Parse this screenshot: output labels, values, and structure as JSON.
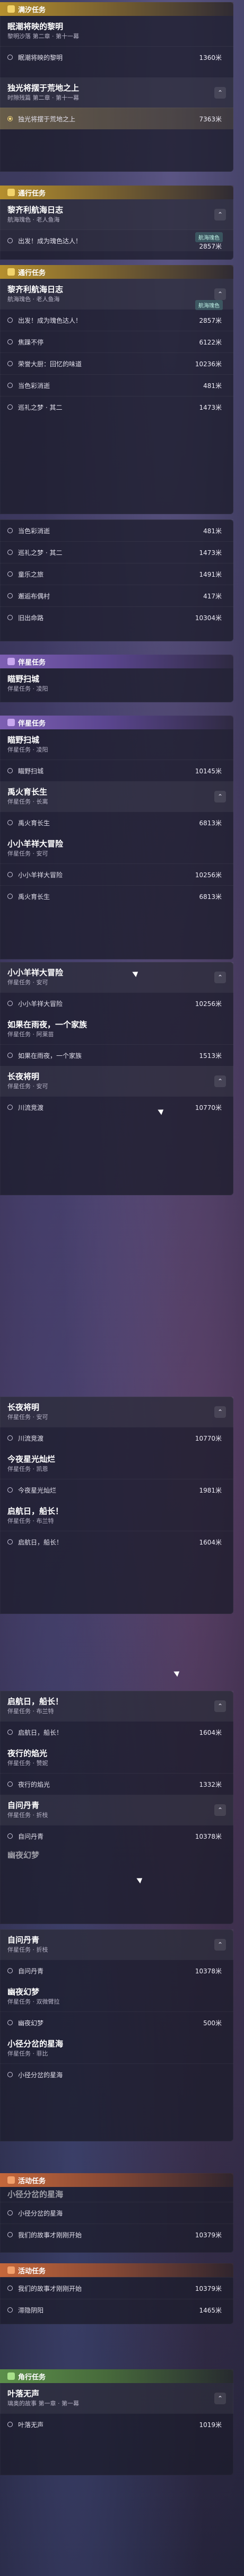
{
  "sec1": {
    "category": "满汐任务",
    "quest1": {
      "title": "眠潮将映的黎明",
      "subtitle": "黎明沙落 第二章 · 第十一幕"
    },
    "quest1_row": {
      "label": "眠潮将映的黎明",
      "value": "1360米"
    },
    "quest2": {
      "title": "独光将摆于荒地之上",
      "subtitle": "时隙残篇 第二章 · 第十一幕"
    },
    "quest2_row": {
      "label": "独光将摆于荒地之上",
      "value": "7363米"
    }
  },
  "sec2": {
    "category": "通行任务",
    "quest": {
      "title": "黎齐利航海日志",
      "subtitle": "航海瑰色 · 老人鱼海"
    },
    "tag": "航海瑰色",
    "row1": {
      "label": "出发！成为瑰色达人！",
      "value": "2857米"
    }
  },
  "sec3": {
    "category": "通行任务",
    "quest": {
      "title": "黎齐利航海日志",
      "subtitle": "航海瑰色 · 老人鱼海"
    },
    "tag": "航海瑰色",
    "rows": [
      {
        "label": "出发！成为瑰色达人！",
        "value": "2857米"
      },
      {
        "label": "焦躁不停",
        "value": "6122米"
      },
      {
        "label": "荣誉大厨：回忆的味道",
        "value": "10236米"
      },
      {
        "label": "当色彩消逝",
        "value": "481米"
      },
      {
        "label": "巡礼之梦 · 其二",
        "value": "1473米"
      },
      {
        "label": "当色彩消逝",
        "value": "481米"
      },
      {
        "label": "巡礼之梦 · 其二",
        "value": "1473米"
      },
      {
        "label": "童乐之旅",
        "value": "1491米"
      },
      {
        "label": "邂逅布偶村",
        "value": "417米"
      },
      {
        "label": "旧出命路",
        "value": "10304米"
      }
    ]
  },
  "sec4": {
    "category": "伴星任务",
    "quest": {
      "title": "瞄野扫城",
      "subtitle": "伴星任务 · 凌阳"
    }
  },
  "sec5": {
    "category": "伴星任务",
    "items": [
      {
        "title": "瞄野扫城",
        "subtitle": "伴星任务 · 凌阳",
        "row": "瞄野扫城",
        "value": "10145米"
      },
      {
        "title": "禹火育长生",
        "subtitle": "伴星任务 · 长离",
        "row": "禹火育长生",
        "value": "6813米"
      },
      {
        "title": "小小羊祥大冒险",
        "subtitle": "伴星任务 · 安可",
        "row": "小小羊祥大冒险",
        "value": "10256米"
      }
    ],
    "extra_row": {
      "label": "禹火育长生",
      "value": "6813米"
    }
  },
  "sec6": {
    "items": [
      {
        "title": "小小羊祥大冒险",
        "subtitle": "伴星任务 · 安可",
        "row": "小小羊祥大冒险",
        "value": "10256米"
      },
      {
        "title": "如果在雨夜，一个家族",
        "subtitle": "伴星任务 · 阿莱苗",
        "row": "如果在雨夜，一个家族",
        "value": "1513米"
      },
      {
        "title": "长夜将明",
        "subtitle": "伴星任务 · 安可",
        "row": "川流竞渡",
        "value": "10770米"
      }
    ]
  },
  "sec7": {
    "items": [
      {
        "title": "长夜将明",
        "subtitle": "伴星任务 · 安可",
        "row": "川流竞渡",
        "value": "10770米"
      },
      {
        "title": "今夜星光灿烂",
        "subtitle": "伴星任务 · 凯恩",
        "row": "今夜星光灿烂",
        "value": "1981米"
      },
      {
        "title": "启航日，船长！",
        "subtitle": "伴星任务 · 布兰特",
        "row": "启航日，船长！",
        "value": "1604米"
      }
    ]
  },
  "sec8": {
    "items": [
      {
        "title": "启航日，船长！",
        "subtitle": "伴星任务 · 布兰特",
        "row": "启航日，船长！",
        "value": "1604米"
      },
      {
        "title": "夜行的焰光",
        "subtitle": "伴星任务 · 赞妮",
        "row": "夜行的焰光",
        "value": "1332米"
      },
      {
        "title": "自问丹青",
        "subtitle": "伴星任务 · 折枝",
        "row": "自问丹青",
        "value": "10378米"
      }
    ],
    "trailing": "幽夜幻梦"
  },
  "sec9": {
    "items": [
      {
        "title": "自问丹青",
        "subtitle": "伴星任务 · 折枝",
        "row": "自问丹青",
        "value": "10378米"
      },
      {
        "title": "幽夜幻梦",
        "subtitle": "伴星任务 · 双微臂拉",
        "row": "幽夜幻梦",
        "value": "500米"
      },
      {
        "title": "小径分岔的星海",
        "subtitle": "伴星任务 · 菲比",
        "row": "小径分岔的星海",
        "value": ""
      }
    ]
  },
  "sec10": {
    "category": "活动任务",
    "quest": {
      "title": "小径分岔的星海",
      "subtitle": ""
    },
    "rows": [
      {
        "label": "小径分岔的星海",
        "value": ""
      },
      {
        "label": "我们的故事才刚刚开始",
        "value": "10379米"
      }
    ]
  },
  "sec11": {
    "category": "活动任务",
    "rows": [
      {
        "label": "我们的故事才刚刚开始",
        "value": "10379米"
      },
      {
        "label": "滞隐阴阳",
        "value": "1465米"
      }
    ]
  },
  "sec12": {
    "category": "角行任务",
    "quest": {
      "title": "叶落无声",
      "subtitle": "璃奥的故事 第一章 · 第一幕"
    },
    "row": {
      "label": "叶落无声",
      "value": "1019米"
    }
  }
}
